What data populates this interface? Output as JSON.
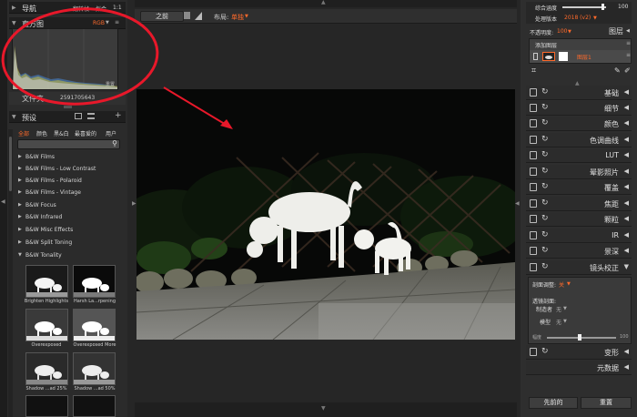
{
  "navigator": {
    "title": "导航",
    "options": [
      "翻转帧",
      "拟合",
      "1:1"
    ]
  },
  "histogram": {
    "title": "直方图",
    "mode": "RGB",
    "reset_label": "重置",
    "file_label": "文件夹",
    "file_value": "2591705643"
  },
  "presets": {
    "title": "预设",
    "tabs": [
      "全部",
      "颜色",
      "黑&白",
      "最喜爱的",
      "用户"
    ],
    "search_placeholder": "",
    "items": [
      "B&W Films",
      "B&W Films - Low Contrast",
      "B&W Films - Polaroid",
      "B&W Films - Vintage",
      "B&W Focus",
      "B&W Infrared",
      "B&W Misc Effects",
      "B&W Split Toning",
      "B&W Tonality"
    ],
    "thumbs": [
      {
        "caption": "Brighten Highlights"
      },
      {
        "caption": "Harsh La...rpening"
      },
      {
        "caption": "Overexposed"
      },
      {
        "caption": "Overexposed More"
      },
      {
        "caption": "Shadow ...ad 25%"
      },
      {
        "caption": "Shadow ...ad 50%"
      }
    ]
  },
  "toolbar": {
    "before_label": "之前",
    "layout_label": "布局:",
    "layout_value": "单独"
  },
  "layers_panel": {
    "blend_label": "综合涵度",
    "blend_value": "100",
    "process_label": "处理版本",
    "process_value": "2018 (v2)",
    "opacity_label": "不透明度:",
    "opacity_value": "100",
    "layers_label": "图层",
    "add_layer_label": "添加图层",
    "layer_name": "图层1"
  },
  "adjustments": [
    "基础",
    "细节",
    "颜色",
    "色调曲线",
    "LUT",
    "晕影照片",
    "覆盖",
    "焦距",
    "颗粒",
    "IR",
    "景深",
    "镜头校正"
  ],
  "lens": {
    "profile_label": "剖面调整:",
    "profile_value": "关",
    "manual_label": "透镜剖面:",
    "maker_label": "制造者",
    "maker_value": "无",
    "model_label": "模型",
    "model_value": "无",
    "amount_label": "幅度",
    "amount_value": "100"
  },
  "bottom_adjustments": [
    "变形",
    "元数据"
  ],
  "footer": {
    "previous_label": "先前的",
    "reset_label": "重置"
  },
  "colors": {
    "accent": "#ff6a2b",
    "annotation": "#e8182a"
  }
}
